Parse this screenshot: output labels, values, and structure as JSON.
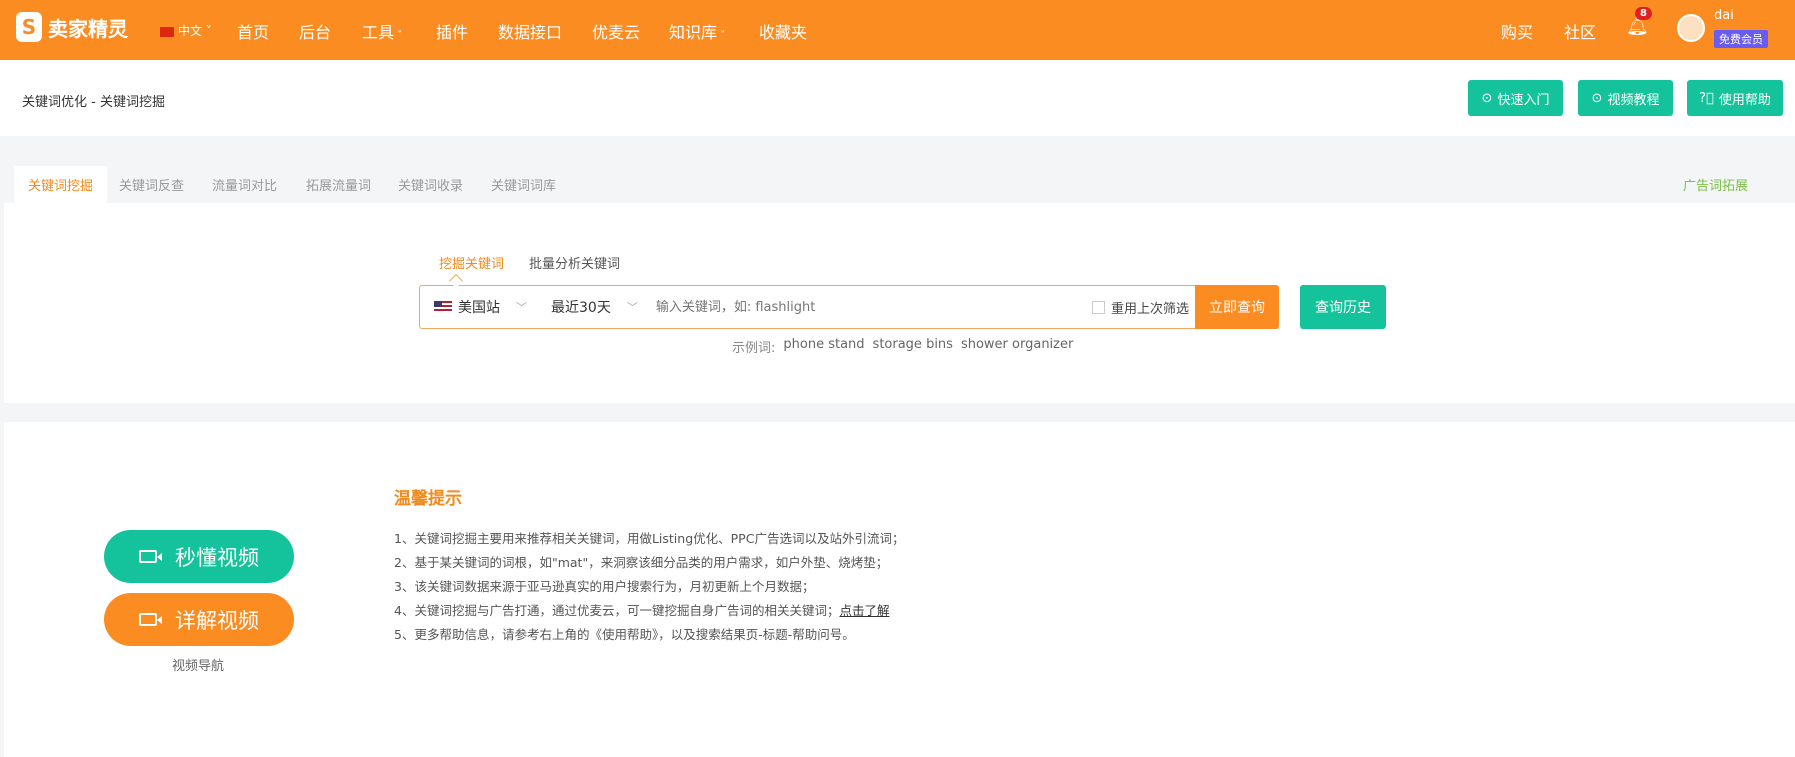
{
  "header": {
    "logo": "卖家精灵",
    "lang": "中文",
    "nav": [
      "首页",
      "后台",
      "工具",
      "插件",
      "数据接口",
      "优麦云",
      "知识库",
      "收藏夹"
    ],
    "buy": "购买",
    "community": "社区",
    "notifications": "8",
    "user": "dai",
    "member": "免费会员"
  },
  "breadcrumb": "关键词优化 - 关键词挖掘",
  "top_buttons": [
    "快速入门",
    "视频教程",
    "使用帮助"
  ],
  "tabs": [
    "关键词挖掘",
    "关键词反查",
    "流量词对比",
    "拓展流量词",
    "关键词收录",
    "关键词词库"
  ],
  "ad_tab": "广告词拓展",
  "search": {
    "subtabs": [
      "挖掘关键词",
      "批量分析关键词"
    ],
    "market": "美国站",
    "period": "最近30天",
    "placeholder": "输入关键词，如: flashlight",
    "reuse": "重用上次筛选",
    "submit": "立即查询",
    "history": "查询历史",
    "examples_label": "示例词:",
    "examples": [
      "phone stand",
      "storage bins",
      "shower organizer"
    ]
  },
  "video": {
    "quick": "秒懂视频",
    "detail": "详解视频",
    "nav": "视频导航"
  },
  "tips": {
    "title": "温馨提示",
    "lines": [
      "1、关键词挖掘主要用来推荐相关关键词，用做Listing优化、PPC广告选词以及站外引流词；",
      "2、基于某关键词的词根，如\"mat\"，来洞察该细分品类的用户需求，如户外垫、烧烤垫；",
      "3、该关键词数据来源于亚马逊真实的用户搜索行为，月初更新上个月数据；",
      "4、关键词挖掘与广告打通，通过优麦云，可一键挖掘自身广告词的相关关键词；",
      "5、更多帮助信息，请参考右上角的《使用帮助》，以及搜索结果页-标题-帮助问号。"
    ],
    "link": "点击了解"
  }
}
